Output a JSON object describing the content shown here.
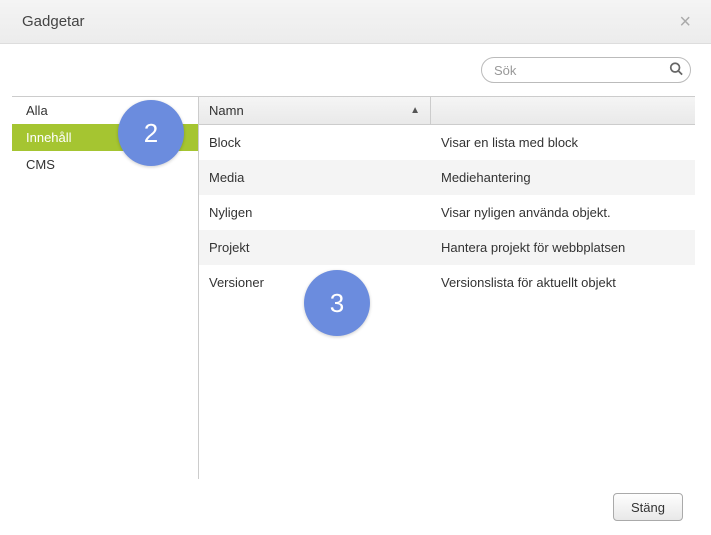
{
  "header": {
    "title": "Gadgetar"
  },
  "search": {
    "placeholder": "Sök"
  },
  "sidebar": {
    "activeIndex": 1,
    "items": [
      {
        "label": "Alla"
      },
      {
        "label": "Innehåll"
      },
      {
        "label": "CMS"
      }
    ]
  },
  "columns": {
    "name": "Namn",
    "desc": ""
  },
  "rows": [
    {
      "name": "Block",
      "desc": "Visar en lista med block"
    },
    {
      "name": "Media",
      "desc": "Mediehantering"
    },
    {
      "name": "Nyligen",
      "desc": "Visar nyligen använda objekt."
    },
    {
      "name": "Projekt",
      "desc": "Hantera projekt för webbplatsen"
    },
    {
      "name": "Versioner",
      "desc": "Versionslista för aktuellt objekt"
    }
  ],
  "footer": {
    "close": "Stäng"
  },
  "callouts": {
    "c2": "2",
    "c3": "3"
  }
}
